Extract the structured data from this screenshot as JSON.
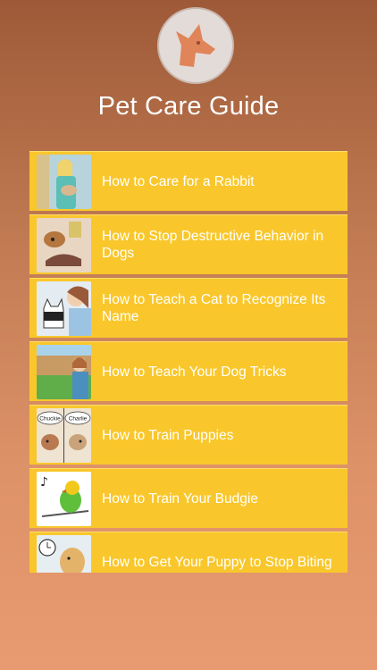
{
  "app": {
    "title": "Pet Care Guide",
    "logo_icon": "dog-head-icon",
    "accent_color": "#f9c72c"
  },
  "articles": [
    {
      "label": "How to Care for a Rabbit",
      "thumb_icon": "person-holding-rabbit-image"
    },
    {
      "label": "How to Stop Destructive Behavior in Dogs",
      "thumb_icon": "dog-chewing-shoe-image"
    },
    {
      "label": "How to Teach a Cat to Recognize Its Name",
      "thumb_icon": "person-and-cat-image"
    },
    {
      "label": "How to Teach Your Dog Tricks",
      "thumb_icon": "person-in-yard-image"
    },
    {
      "label": "How to Train Puppies",
      "thumb_icon": "two-puppies-comic-image",
      "thumb_text": [
        "Chuckie",
        "Charlie"
      ]
    },
    {
      "label": "How to Train Your Budgie",
      "thumb_icon": "singing-budgie-image"
    },
    {
      "label": "How to Get Your Puppy to Stop Biting",
      "thumb_icon": "puppy-and-clock-image"
    }
  ]
}
